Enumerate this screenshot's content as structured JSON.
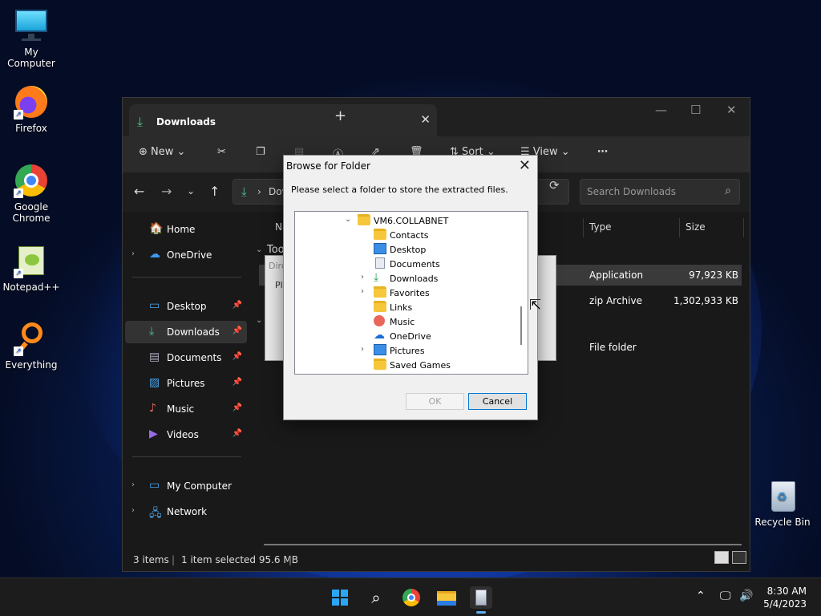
{
  "desktop": {
    "icons": [
      {
        "label": "My Computer"
      },
      {
        "label": "Firefox"
      },
      {
        "label": "Google Chrome"
      },
      {
        "label": "Notepad++"
      },
      {
        "label": "Everything"
      },
      {
        "label": "Recycle Bin"
      }
    ]
  },
  "explorer": {
    "tab_title": "Downloads",
    "toolbar": {
      "new_label": "New",
      "sort_label": "Sort",
      "view_label": "View"
    },
    "address_partial": "Dov",
    "search_placeholder": "Search Downloads",
    "sidebar": [
      {
        "label": "Home",
        "icon": "home-icon"
      },
      {
        "label": "OneDrive",
        "icon": "cloud-icon"
      },
      {
        "label": "Desktop",
        "icon": "desktop-icon",
        "pinned": true
      },
      {
        "label": "Downloads",
        "icon": "download-icon",
        "pinned": true,
        "selected": true
      },
      {
        "label": "Documents",
        "icon": "document-icon",
        "pinned": true
      },
      {
        "label": "Pictures",
        "icon": "picture-icon",
        "pinned": true
      },
      {
        "label": "Music",
        "icon": "music-icon",
        "pinned": true
      },
      {
        "label": "Videos",
        "icon": "video-icon",
        "pinned": true
      },
      {
        "label": "My Computer",
        "icon": "computer-icon"
      },
      {
        "label": "Network",
        "icon": "network-icon"
      }
    ],
    "columns": {
      "name": "Na",
      "type": "Type",
      "size": "Size"
    },
    "group_partial": "Too",
    "rows": [
      {
        "type": "Application",
        "size": "97,923 KB",
        "selected": true
      },
      {
        "type": "zip Archive",
        "size": "1,302,933 KB"
      },
      {
        "type": "File folder",
        "size": ""
      }
    ],
    "status": {
      "items": "3 items",
      "selected": "1 item selected  95.6 MB"
    }
  },
  "ghost_dialog": {
    "title_partial": "Dire",
    "text_partial": "Ple"
  },
  "dialog": {
    "title": "Browse for Folder",
    "message": "Please select a folder to store the extracted files.",
    "tree": [
      {
        "label": "VM6.COLLABNET",
        "depth": 0,
        "expander": "open",
        "icon": "folder"
      },
      {
        "label": "Contacts",
        "depth": 1,
        "expander": "",
        "icon": "folder"
      },
      {
        "label": "Desktop",
        "depth": 1,
        "expander": "",
        "icon": "desktop"
      },
      {
        "label": "Documents",
        "depth": 1,
        "expander": "",
        "icon": "document"
      },
      {
        "label": "Downloads",
        "depth": 1,
        "expander": "closed",
        "icon": "download"
      },
      {
        "label": "Favorites",
        "depth": 1,
        "expander": "closed",
        "icon": "folder"
      },
      {
        "label": "Links",
        "depth": 1,
        "expander": "",
        "icon": "folder"
      },
      {
        "label": "Music",
        "depth": 1,
        "expander": "",
        "icon": "music"
      },
      {
        "label": "OneDrive",
        "depth": 1,
        "expander": "",
        "icon": "cloud"
      },
      {
        "label": "Pictures",
        "depth": 1,
        "expander": "closed",
        "icon": "picture"
      },
      {
        "label": "Saved Games",
        "depth": 1,
        "expander": "",
        "icon": "folder"
      }
    ],
    "ok_label": "OK",
    "cancel_label": "Cancel"
  },
  "taskbar": {
    "time": "8:30 AM",
    "date": "5/4/2023"
  }
}
